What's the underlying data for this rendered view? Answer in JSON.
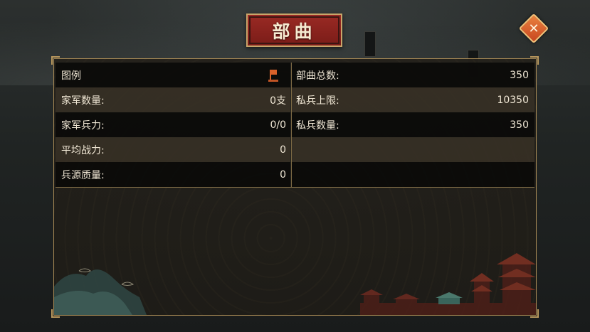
{
  "title": "部曲",
  "close_icon_glyph": "✕",
  "legend": {
    "label": "图例",
    "icon": "banner-legend-icon"
  },
  "left_rows": [
    {
      "label": "家军数量:",
      "value": "0支"
    },
    {
      "label": "家军兵力:",
      "value": "0/0"
    },
    {
      "label": "平均战力:",
      "value": "0"
    },
    {
      "label": "兵源质量:",
      "value": "0"
    }
  ],
  "right_rows": [
    {
      "label": "部曲总数:",
      "value": "350"
    },
    {
      "label": "私兵上限:",
      "value": "10350"
    },
    {
      "label": "私兵数量:",
      "value": "350"
    },
    {
      "label": "",
      "value": ""
    },
    {
      "label": "",
      "value": ""
    }
  ],
  "colors": {
    "title_plaque": "#8a221d",
    "close_button": "#d9622a",
    "panel_border": "#a88a55"
  }
}
